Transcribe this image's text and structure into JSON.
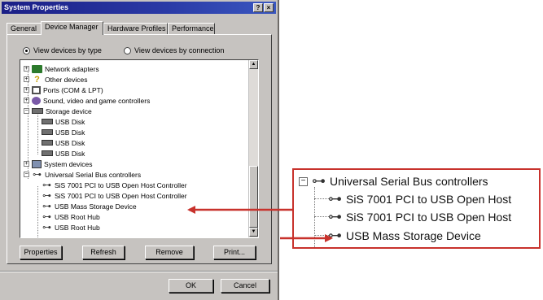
{
  "window": {
    "title": "System Properties",
    "help_glyph": "?",
    "close_glyph": "×"
  },
  "tabs": [
    {
      "label": "General"
    },
    {
      "label": "Device Manager"
    },
    {
      "label": "Hardware Profiles"
    },
    {
      "label": "Performance"
    }
  ],
  "view_options": {
    "by_type": "View devices by type",
    "by_connection": "View devices by connection",
    "selected": "by_type"
  },
  "tree": {
    "items": [
      {
        "label": "Network adapters",
        "icon": "network-icon",
        "expander": "+"
      },
      {
        "label": "Other devices",
        "icon": "question-icon",
        "expander": "+"
      },
      {
        "label": "Ports (COM & LPT)",
        "icon": "port-icon",
        "expander": "+"
      },
      {
        "label": "Sound, video and game controllers",
        "icon": "sound-icon",
        "expander": "+"
      },
      {
        "label": "Storage device",
        "icon": "storage-icon",
        "expander": "−"
      },
      {
        "label": "USB Disk",
        "icon": "disk-icon"
      },
      {
        "label": "USB Disk",
        "icon": "disk-icon"
      },
      {
        "label": "USB Disk",
        "icon": "disk-icon"
      },
      {
        "label": "USB Disk",
        "icon": "disk-icon"
      },
      {
        "label": "System devices",
        "icon": "computer-icon",
        "expander": "+"
      },
      {
        "label": "Universal Serial Bus controllers",
        "icon": "usb-icon",
        "expander": "−"
      },
      {
        "label": "SiS 7001 PCI to USB Open Host Controller",
        "icon": "usb-icon"
      },
      {
        "label": "SiS 7001 PCI to USB Open Host Controller",
        "icon": "usb-icon"
      },
      {
        "label": "USB Mass Storage Device",
        "icon": "usb-icon"
      },
      {
        "label": "USB Root Hub",
        "icon": "usb-icon"
      },
      {
        "label": "USB Root Hub",
        "icon": "usb-icon"
      }
    ]
  },
  "buttons": {
    "properties": "Properties",
    "refresh": "Refresh",
    "remove": "Remove",
    "print": "Print...",
    "ok": "OK",
    "cancel": "Cancel"
  },
  "zoom": {
    "items": [
      {
        "label": "Universal Serial Bus controllers",
        "expander": "−"
      },
      {
        "label": "SiS 7001 PCI to USB Open Host"
      },
      {
        "label": "SiS 7001 PCI to USB Open Host"
      },
      {
        "label": "USB Mass Storage Device"
      }
    ]
  },
  "colors": {
    "callout_red": "#c8322c",
    "title_blue": "#1b1f86"
  }
}
